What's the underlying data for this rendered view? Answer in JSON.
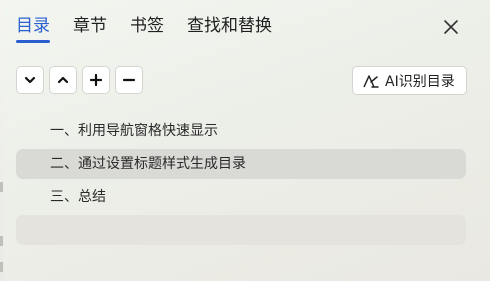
{
  "tabs": [
    {
      "label": "目录",
      "active": true
    },
    {
      "label": "章节",
      "active": false
    },
    {
      "label": "书签",
      "active": false
    },
    {
      "label": "查找和替换",
      "active": false
    }
  ],
  "toolbar": {
    "buttons": [
      {
        "icon": "chevron-down-icon"
      },
      {
        "icon": "chevron-up-icon"
      },
      {
        "icon": "plus-icon"
      },
      {
        "icon": "minus-icon"
      }
    ],
    "ai_button_label": "AI识别目录"
  },
  "outline": {
    "items": [
      {
        "label": "一、利用导航窗格快速显示",
        "selected": false
      },
      {
        "label": "二、通过设置标题样式生成目录",
        "selected": true
      },
      {
        "label": "三、总结",
        "selected": false
      },
      {
        "label": "",
        "selected": false
      }
    ]
  },
  "colors": {
    "accent": "#2b5fd0",
    "selected_row": "#d9dad5",
    "empty_row": "#e4e3de"
  }
}
